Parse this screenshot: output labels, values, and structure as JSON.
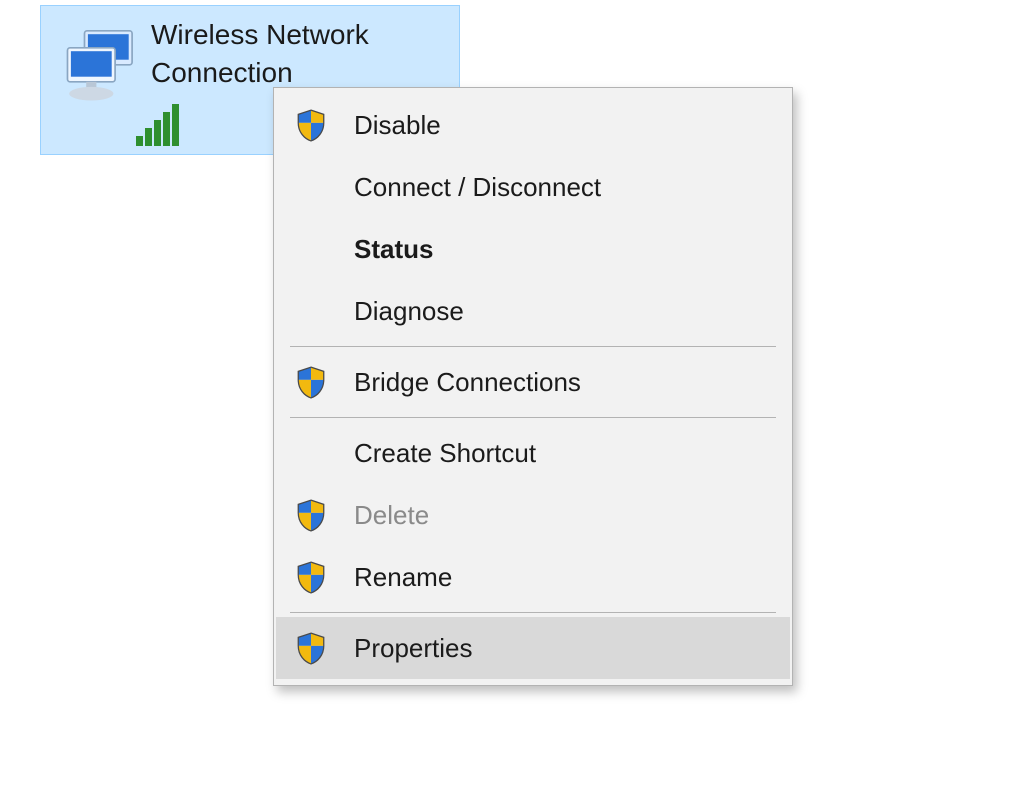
{
  "adapter": {
    "line1": "Wireless Network",
    "line2": "Connection"
  },
  "menu": {
    "items": [
      {
        "label": "Disable",
        "shield": true
      },
      {
        "label": "Connect / Disconnect",
        "shield": false
      },
      {
        "label": "Status",
        "shield": false,
        "bold": true
      },
      {
        "label": "Diagnose",
        "shield": false
      },
      {
        "label": "Bridge Connections",
        "shield": true
      },
      {
        "label": "Create Shortcut",
        "shield": false
      },
      {
        "label": "Delete",
        "shield": true,
        "disabled": true
      },
      {
        "label": "Rename",
        "shield": true
      },
      {
        "label": "Properties",
        "shield": true,
        "hover": true
      }
    ]
  }
}
